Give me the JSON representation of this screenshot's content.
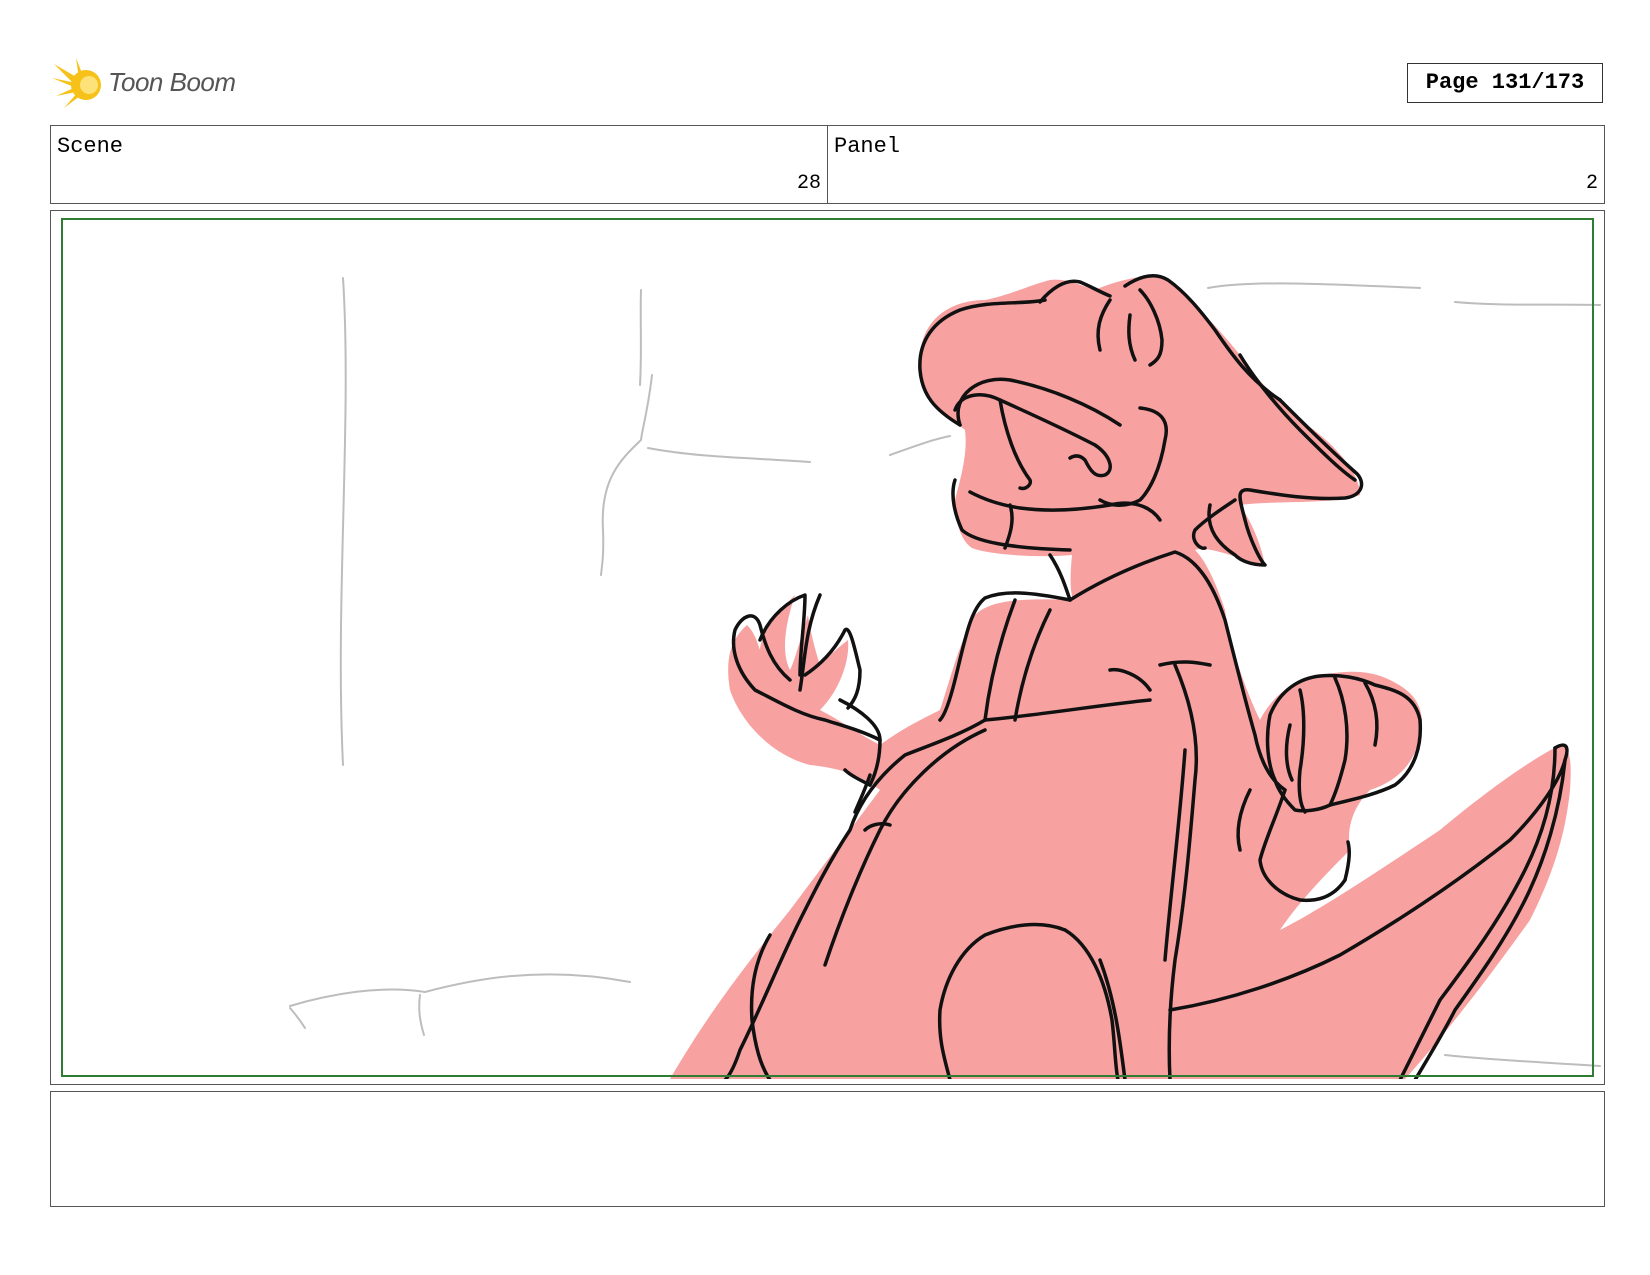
{
  "header": {
    "logo_text": "Toon Boom",
    "page_label": "Page 131/173"
  },
  "scene": {
    "label": "Scene",
    "value": "28"
  },
  "panel": {
    "label": "Panel",
    "value": "2"
  },
  "drawing": {
    "subject": "dinosaur-character-laughing",
    "fill_color": "#f7a1a1",
    "line_color": "#111111",
    "background_line_color": "#bdbdbd",
    "safe_frame_color": "#2e7d32"
  },
  "notes": {
    "text": ""
  }
}
